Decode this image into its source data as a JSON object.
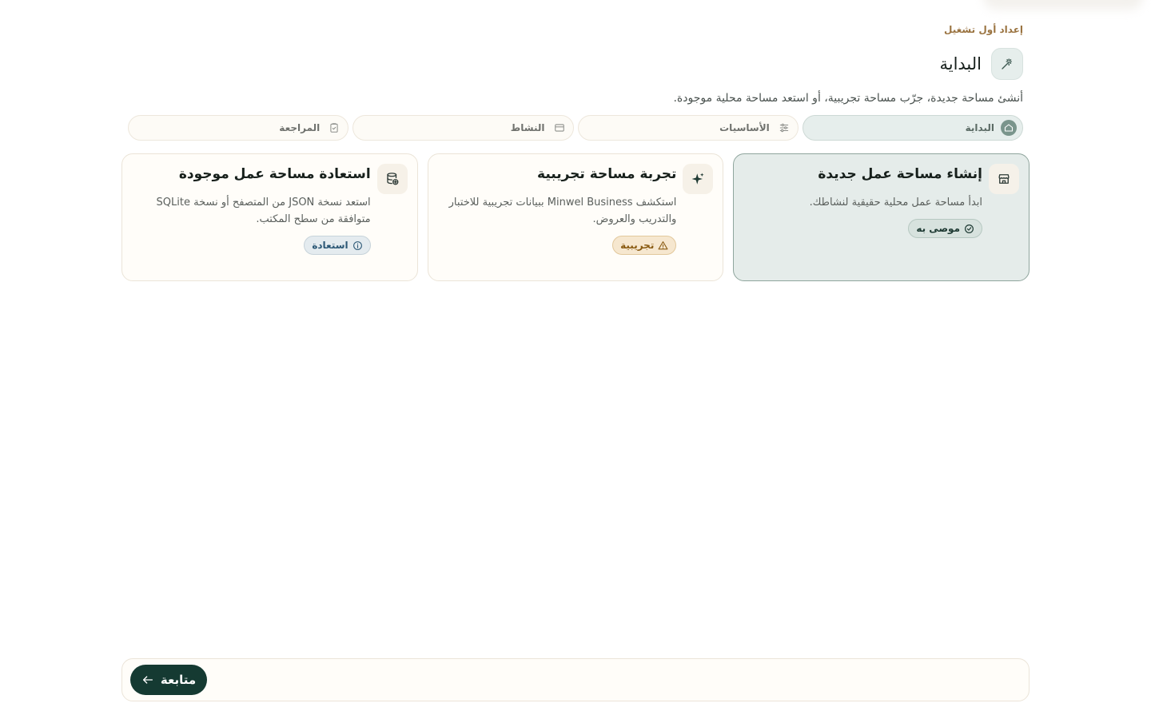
{
  "header": {
    "eyebrow": "إعداد أول تشغيل",
    "title": "البداية",
    "title_icon": "magic-wand-icon",
    "subtitle": "أنشئ مساحة جديدة، جرّب مساحة تجريبية، أو استعد مساحة محلية موجودة."
  },
  "steps": [
    {
      "label": "البداية",
      "icon": "home-icon",
      "active": true
    },
    {
      "label": "الأساسيات",
      "icon": "sliders-icon",
      "active": false
    },
    {
      "label": "النشاط",
      "icon": "inbox-icon",
      "active": false
    },
    {
      "label": "المراجعة",
      "icon": "clipboard-check-icon",
      "active": false
    }
  ],
  "cards": [
    {
      "title": "إنشاء مساحة عمل جديدة",
      "description": "ابدأ مساحة عمل محلية حقيقية لنشاطك.",
      "badge": "موصى به",
      "icon": "store-icon",
      "selected": true
    },
    {
      "title": "تجربة مساحة تجريبية",
      "description": "استكشف Minwel Business ببيانات تجريبية للاختبار والتدريب والعروض.",
      "badge": "تجريبية",
      "icon": "sparkles-icon",
      "selected": false
    },
    {
      "title": "استعادة مساحة عمل موجودة",
      "description": "استعد نسخة JSON من المتصفح أو نسخة SQLite متوافقة من سطح المكتب.",
      "badge": "استعادة",
      "icon": "database-restore-icon",
      "selected": false
    }
  ],
  "footer": {
    "continue_label": "متابعة"
  },
  "colors": {
    "accent": "#153a32",
    "selected_bg": "#e5ecea",
    "eyebrow": "#9a7340"
  }
}
